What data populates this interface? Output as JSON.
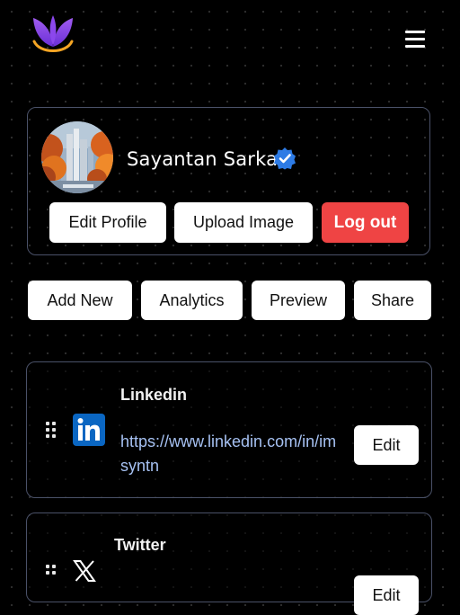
{
  "header": {
    "logo_icon": "violet-leaf-logo-icon",
    "menu_icon": "hamburger-menu-icon"
  },
  "profile": {
    "name": "Sayantan Sarkar",
    "verified_icon": "verified-badge-icon",
    "avatar": "city-autumn-avatar",
    "buttons": {
      "edit_profile": "Edit Profile",
      "upload_image": "Upload Image",
      "logout": "Log out"
    }
  },
  "actions": {
    "add_new": "Add New",
    "analytics": "Analytics",
    "preview": "Preview",
    "share": "Share"
  },
  "links": [
    {
      "title": "Linkedin",
      "url": "https://www.linkedin.com/in/imsyntn",
      "icon": "linkedin-icon",
      "edit_label": "Edit"
    },
    {
      "title": "Twitter",
      "icon": "x-icon",
      "edit_label": "Edit"
    }
  ],
  "colors": {
    "background": "#000000",
    "card_border": "#4a5168",
    "logout": "#ef4444",
    "link_text": "#a6c1f2",
    "verified": "#2d7be5",
    "linkedin": "#0a66c2"
  }
}
